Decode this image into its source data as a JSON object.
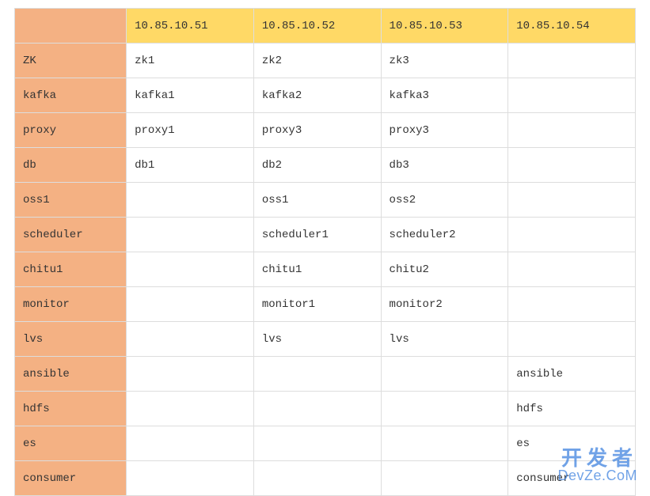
{
  "columns": [
    "",
    "10.85.10.51",
    "10.85.10.52",
    "10.85.10.53",
    "10.85.10.54"
  ],
  "rows": [
    {
      "label": "ZK",
      "cells": [
        "zk1",
        "zk2",
        "zk3",
        ""
      ]
    },
    {
      "label": "kafka",
      "cells": [
        "kafka1",
        "kafka2",
        "kafka3",
        ""
      ]
    },
    {
      "label": "proxy",
      "cells": [
        "proxy1",
        "proxy3",
        "proxy3",
        ""
      ]
    },
    {
      "label": "db",
      "cells": [
        "db1",
        "db2",
        "db3",
        ""
      ]
    },
    {
      "label": "oss1",
      "cells": [
        "",
        "oss1",
        "oss2",
        ""
      ]
    },
    {
      "label": "scheduler",
      "cells": [
        "",
        "scheduler1",
        "scheduler2",
        ""
      ]
    },
    {
      "label": "chitu1",
      "cells": [
        "",
        "chitu1",
        "chitu2",
        ""
      ]
    },
    {
      "label": "monitor",
      "cells": [
        "",
        "monitor1",
        "monitor2",
        ""
      ]
    },
    {
      "label": "lvs",
      "cells": [
        "",
        "lvs",
        "lvs",
        ""
      ]
    },
    {
      "label": "ansible",
      "cells": [
        "",
        "",
        "",
        "ansible"
      ]
    },
    {
      "label": "hdfs",
      "cells": [
        "",
        "",
        "",
        "hdfs"
      ]
    },
    {
      "label": "es",
      "cells": [
        "",
        "",
        "",
        "es"
      ]
    },
    {
      "label": "consumer",
      "cells": [
        "",
        "",
        "",
        "consumer"
      ]
    }
  ],
  "watermark": {
    "line1": "开发者",
    "line2": "DevZe.CoM"
  }
}
